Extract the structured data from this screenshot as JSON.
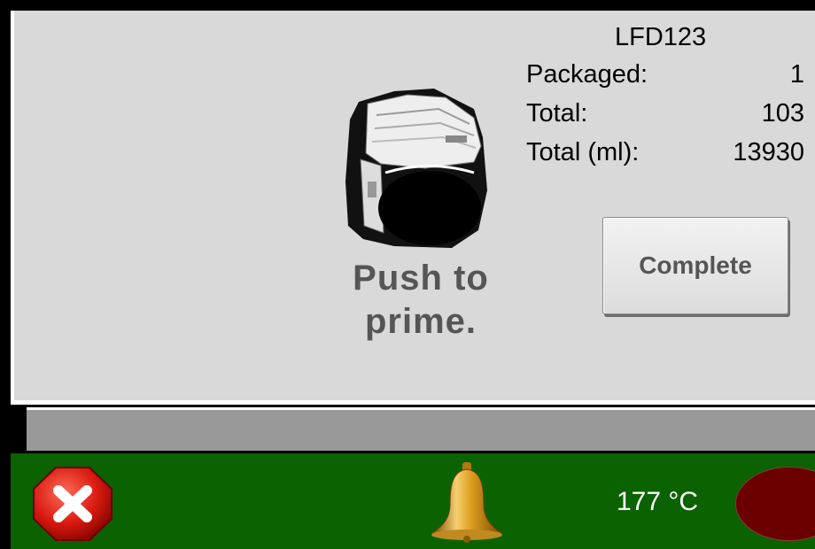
{
  "info": {
    "product_code": "LFD123",
    "rows": [
      {
        "label": "Packaged:",
        "value": "1"
      },
      {
        "label": "Total:",
        "value": "103"
      },
      {
        "label": "Total (ml):",
        "value": "13930"
      }
    ]
  },
  "prime": {
    "line1": "Push to",
    "line2": "prime."
  },
  "buttons": {
    "complete_label": "Complete"
  },
  "status": {
    "temperature": "177 °C",
    "icons": [
      "close-icon",
      "bell-icon"
    ],
    "indicator_color": "#6a0000"
  },
  "colors": {
    "panel_bg": "#d9d9d9",
    "status_bar": "#0b6200",
    "progress_bar": "#999999",
    "prime_text": "#555555"
  }
}
